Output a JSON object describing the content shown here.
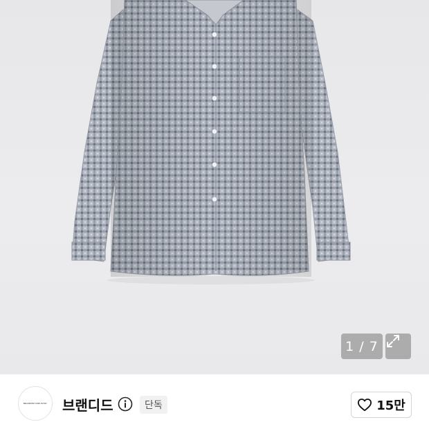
{
  "gallery": {
    "image": "gray-check-long-sleeve-shirt",
    "counter": "1 / 7",
    "expand_icon": "expand-arrows-icon"
  },
  "brand": {
    "logo_text": "BRANDED INDUSTRY",
    "name": "브랜디드",
    "info_icon": "info-icon",
    "badge": "단독"
  },
  "like": {
    "icon": "heart-outline-icon",
    "count": "15만"
  }
}
